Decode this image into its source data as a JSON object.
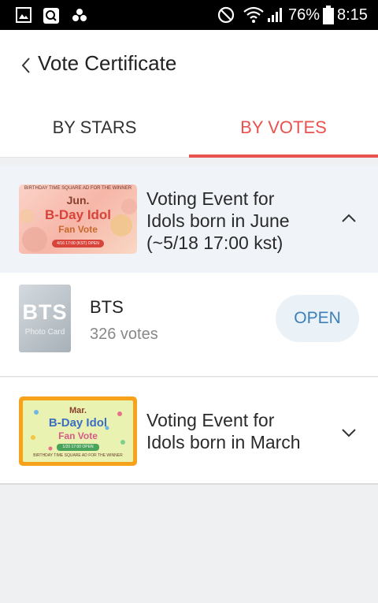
{
  "status_bar": {
    "battery": "76%",
    "time": "8:15"
  },
  "header": {
    "title": "Vote Certificate"
  },
  "tabs": [
    {
      "label": "BY STARS",
      "active": false
    },
    {
      "label": "BY VOTES",
      "active": true
    }
  ],
  "accent_color": "#e9524f",
  "events": [
    {
      "title_line1": "Voting Event for",
      "title_line2": "Idols born in June",
      "title_line3": "(~5/18 17:00 kst)",
      "expanded": true,
      "thumb": {
        "top_text": "BIRTHDAY TIME SQUARE AD FOR THE WINNER",
        "month": "Jun.",
        "line1": "B-Day Idol",
        "line2": "Fan Vote",
        "pill": "4/16 17:00 (KST) OPEN"
      },
      "items": [
        {
          "card_text": "BTS",
          "card_sub": "Photo Card",
          "name": "BTS",
          "votes": "326 votes",
          "button": "OPEN"
        }
      ]
    },
    {
      "title_line1": "Voting Event for",
      "title_line2": "Idols born in March",
      "expanded": false,
      "thumb": {
        "month": "Mar.",
        "line1": "B-Day Idol",
        "line2": "Fan Vote",
        "pill": "1/20 17:00 OPEN",
        "bottom_text": "BIRTHDAY TIME SQUARE AD FOR THE WINNER"
      }
    }
  ]
}
